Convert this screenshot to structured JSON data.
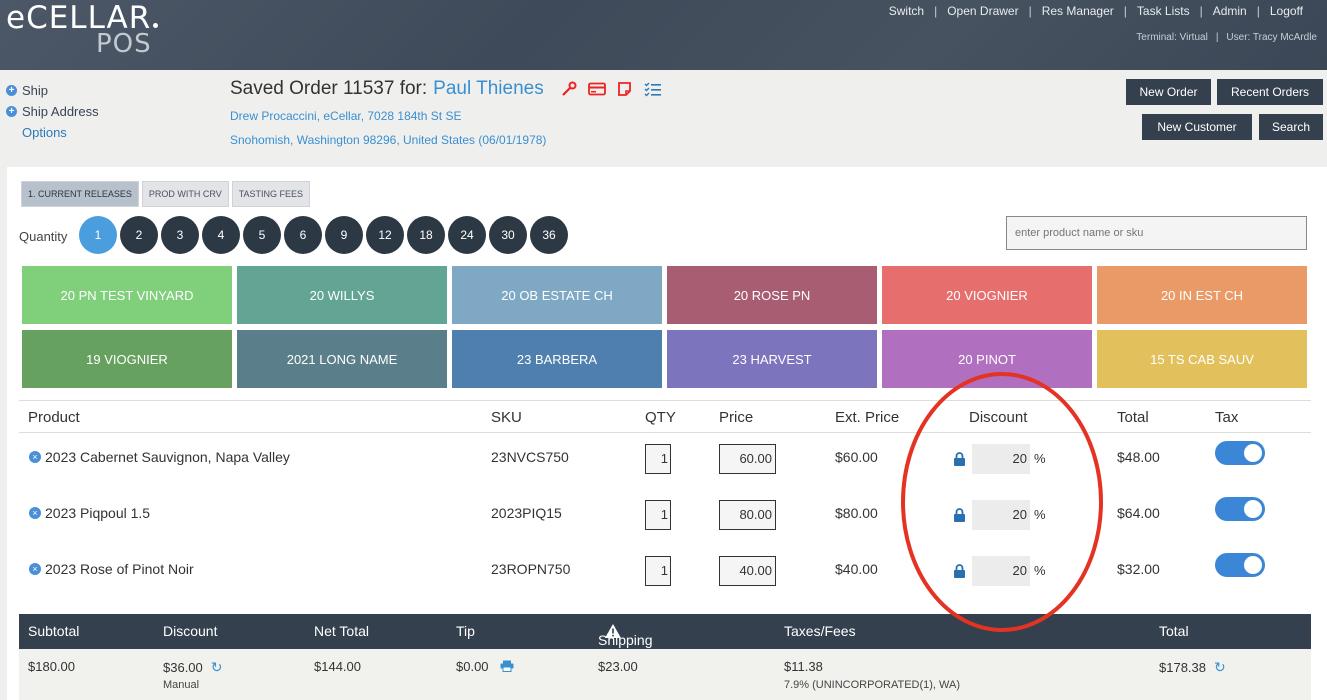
{
  "header": {
    "logo_main": "eCELLAR",
    "logo_sub": "POS",
    "nav": [
      "Switch",
      "Open Drawer",
      "Res Manager",
      "Task Lists",
      "Admin",
      "Logoff"
    ],
    "terminal": "Terminal: Virtual",
    "user": "User: Tracy McArdle"
  },
  "left_links": {
    "ship": "Ship",
    "ship_address": "Ship Address",
    "options": "Options"
  },
  "order": {
    "title": "Saved Order 11537 for:",
    "customer": "Paul Thienes",
    "address_line1": "Drew Procaccini, eCellar, 7028 184th St SE",
    "address_line2": "Snohomish, Washington 98296, United States (06/01/1978)"
  },
  "buttons": {
    "new_order": "New Order",
    "recent_orders": "Recent Orders",
    "new_customer": "New Customer",
    "search": "Search"
  },
  "tabs": [
    "1. CURRENT RELEASES",
    "PROD WITH CRV",
    "TASTING FEES"
  ],
  "quantity": {
    "label": "Quantity",
    "options": [
      "1",
      "2",
      "3",
      "4",
      "5",
      "6",
      "9",
      "12",
      "18",
      "24",
      "30",
      "36"
    ],
    "selected": "1"
  },
  "search": {
    "placeholder": "enter product name or sku"
  },
  "tiles": [
    {
      "label": "20 PN TEST VINYARD",
      "color": "#7fcf7b"
    },
    {
      "label": "20 WILLYS",
      "color": "#62a595"
    },
    {
      "label": "20 OB ESTATE CH",
      "color": "#7ea8c3"
    },
    {
      "label": "20 ROSE PN",
      "color": "#a95d72"
    },
    {
      "label": "20 VIOGNIER",
      "color": "#e66f6d"
    },
    {
      "label": "20 IN EST CH",
      "color": "#e99a67"
    },
    {
      "label": "19 VIOGNIER",
      "color": "#67a160"
    },
    {
      "label": "2021 LONG NAME",
      "color": "#5a7f8a"
    },
    {
      "label": "23 BARBERA",
      "color": "#4f7fae"
    },
    {
      "label": "23 HARVEST",
      "color": "#7d74be"
    },
    {
      "label": "20 PINOT",
      "color": "#b06fbf"
    },
    {
      "label": "15 TS CAB SAUV",
      "color": "#e2c15d"
    }
  ],
  "table": {
    "headers": {
      "product": "Product",
      "sku": "SKU",
      "qty": "QTY",
      "price": "Price",
      "ext_price": "Ext. Price",
      "discount": "Discount",
      "total": "Total",
      "tax": "Tax"
    },
    "rows": [
      {
        "product": "2023 Cabernet Sauvignon, Napa Valley",
        "sku": "23NVCS750",
        "qty": "1",
        "price": "60.00",
        "ext_price": "$60.00",
        "discount": "20",
        "pct": "%",
        "total": "$48.00",
        "tax_on": true
      },
      {
        "product": "2023 Piqpoul 1.5",
        "sku": "2023PIQ15",
        "qty": "1",
        "price": "80.00",
        "ext_price": "$80.00",
        "discount": "20",
        "pct": "%",
        "total": "$64.00",
        "tax_on": true
      },
      {
        "product": "2023 Rose of Pinot Noir",
        "sku": "23ROPN750",
        "qty": "1",
        "price": "40.00",
        "ext_price": "$40.00",
        "discount": "20",
        "pct": "%",
        "total": "$32.00",
        "tax_on": true
      }
    ]
  },
  "totals": {
    "labels": {
      "subtotal": "Subtotal",
      "discount": "Discount",
      "net_total": "Net Total",
      "tip": "Tip",
      "shipping": "Shipping",
      "taxes": "Taxes/Fees",
      "total": "Total"
    },
    "values": {
      "subtotal": "$180.00",
      "discount": "$36.00",
      "discount_note": "Manual",
      "net_total": "$144.00",
      "tip": "$0.00",
      "shipping": "$23.00",
      "taxes": "$11.38",
      "taxes_note": "7.9% (UNINCORPORATED(1), WA)",
      "total": "$178.38"
    }
  },
  "colors": {
    "accent": "#3a8fd0",
    "dark": "#34404e",
    "annotation": "#e53323"
  }
}
